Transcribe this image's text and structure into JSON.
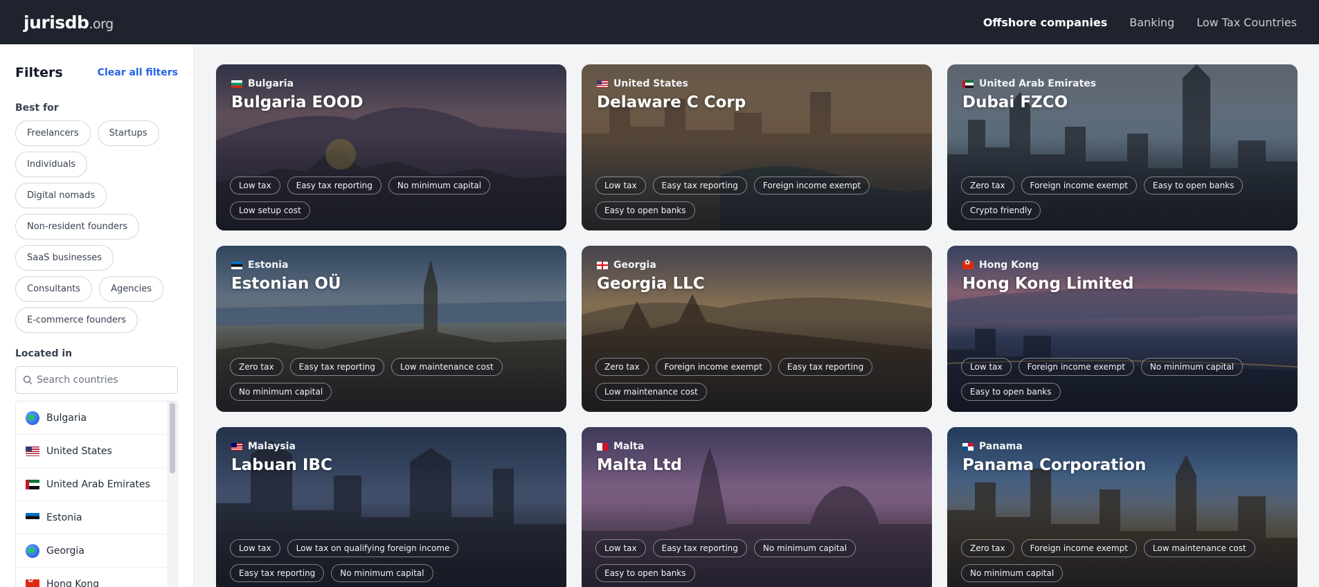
{
  "header": {
    "logo_main": "jurisdb",
    "logo_tld": ".org",
    "nav": [
      "Offshore companies",
      "Banking",
      "Low Tax Countries"
    ]
  },
  "filters": {
    "title": "Filters",
    "clear": "Clear all filters",
    "best_for_label": "Best for",
    "best_for": [
      "Freelancers",
      "Startups",
      "Individuals",
      "Digital nomads",
      "Non-resident founders",
      "SaaS businesses",
      "Consultants",
      "Agencies",
      "E-commerce founders"
    ],
    "located_in_label": "Located in",
    "search_placeholder": "Search countries",
    "countries": [
      {
        "name": "Bulgaria",
        "icon": "globe-icon"
      },
      {
        "name": "United States",
        "icon": "us-flag-icon"
      },
      {
        "name": "United Arab Emirates",
        "icon": "uae-flag-icon"
      },
      {
        "name": "Estonia",
        "icon": "estonia-flag-icon"
      },
      {
        "name": "Georgia",
        "icon": "globe-icon"
      },
      {
        "name": "Hong Kong",
        "icon": "hong-kong-flag-icon"
      }
    ]
  },
  "cards": [
    {
      "country": "Bulgaria",
      "title": "Bulgaria EOOD",
      "tags": [
        "Low tax",
        "Easy tax reporting",
        "No minimum capital",
        "Low setup cost"
      ]
    },
    {
      "country": "United States",
      "title": "Delaware C Corp",
      "tags": [
        "Low tax",
        "Easy tax reporting",
        "Foreign income exempt",
        "Easy to open banks"
      ]
    },
    {
      "country": "United Arab Emirates",
      "title": "Dubai FZCO",
      "tags": [
        "Zero tax",
        "Foreign income exempt",
        "Easy to open banks",
        "Crypto friendly"
      ]
    },
    {
      "country": "Estonia",
      "title": "Estonian OÜ",
      "tags": [
        "Zero tax",
        "Easy tax reporting",
        "Low maintenance cost",
        "No minimum capital"
      ]
    },
    {
      "country": "Georgia",
      "title": "Georgia LLC",
      "tags": [
        "Zero tax",
        "Foreign income exempt",
        "Easy tax reporting",
        "Low maintenance cost"
      ]
    },
    {
      "country": "Hong Kong",
      "title": "Hong Kong Limited",
      "tags": [
        "Low tax",
        "Foreign income exempt",
        "No minimum capital",
        "Easy to open banks"
      ]
    },
    {
      "country": "Malaysia",
      "title": "Labuan IBC",
      "tags": [
        "Low tax",
        "Low tax on qualifying foreign income",
        "Easy tax reporting",
        "No minimum capital"
      ]
    },
    {
      "country": "Malta",
      "title": "Malta Ltd",
      "tags": [
        "Low tax",
        "Easy tax reporting",
        "No minimum capital",
        "Easy to open banks"
      ]
    },
    {
      "country": "Panama",
      "title": "Panama Corporation",
      "tags": [
        "Zero tax",
        "Foreign income exempt",
        "Low maintenance cost",
        "No minimum capital"
      ]
    }
  ]
}
